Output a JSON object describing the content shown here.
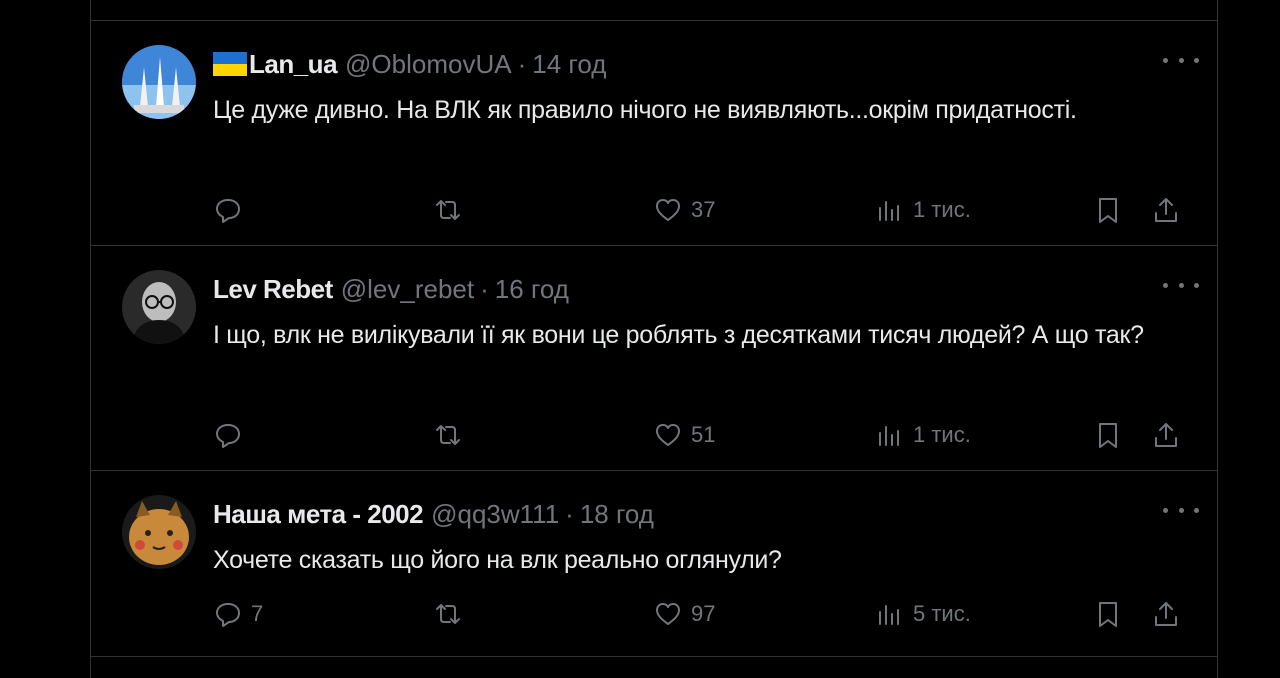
{
  "tweets": [
    {
      "name": "Lan_ua",
      "has_flag": true,
      "handle": "@OblomovUA",
      "separator": "·",
      "time": "14 год",
      "text": "Це дуже дивно. На ВЛК як правило нічого не виявляють...окрім придатності.",
      "replies": "",
      "retweets": "",
      "likes": "37",
      "views": "1 тис."
    },
    {
      "name": "Lev Rebet",
      "has_flag": false,
      "handle": "@lev_rebet",
      "separator": "·",
      "time": "16 год",
      "text": "І що, влк не вилікували її як вони це роблять з десятками тисяч людей? А що так?",
      "replies": "",
      "retweets": "",
      "likes": "51",
      "views": "1 тис."
    },
    {
      "name": "Наша мета - 2002",
      "has_flag": false,
      "handle": "@qq3w111",
      "separator": "·",
      "time": "18 год",
      "text": "Хочете сказать що його на влк реально оглянули?",
      "replies": "7",
      "retweets": "",
      "likes": "97",
      "views": "5 тис."
    }
  ],
  "icons": [
    "reply-icon",
    "retweet-icon",
    "like-icon",
    "views-icon",
    "bookmark-icon",
    "share-icon",
    "more-icon"
  ],
  "colors": {
    "background": "#000000",
    "text": "#e7e9ea",
    "muted": "#71767b",
    "divider": "#2f3336"
  }
}
